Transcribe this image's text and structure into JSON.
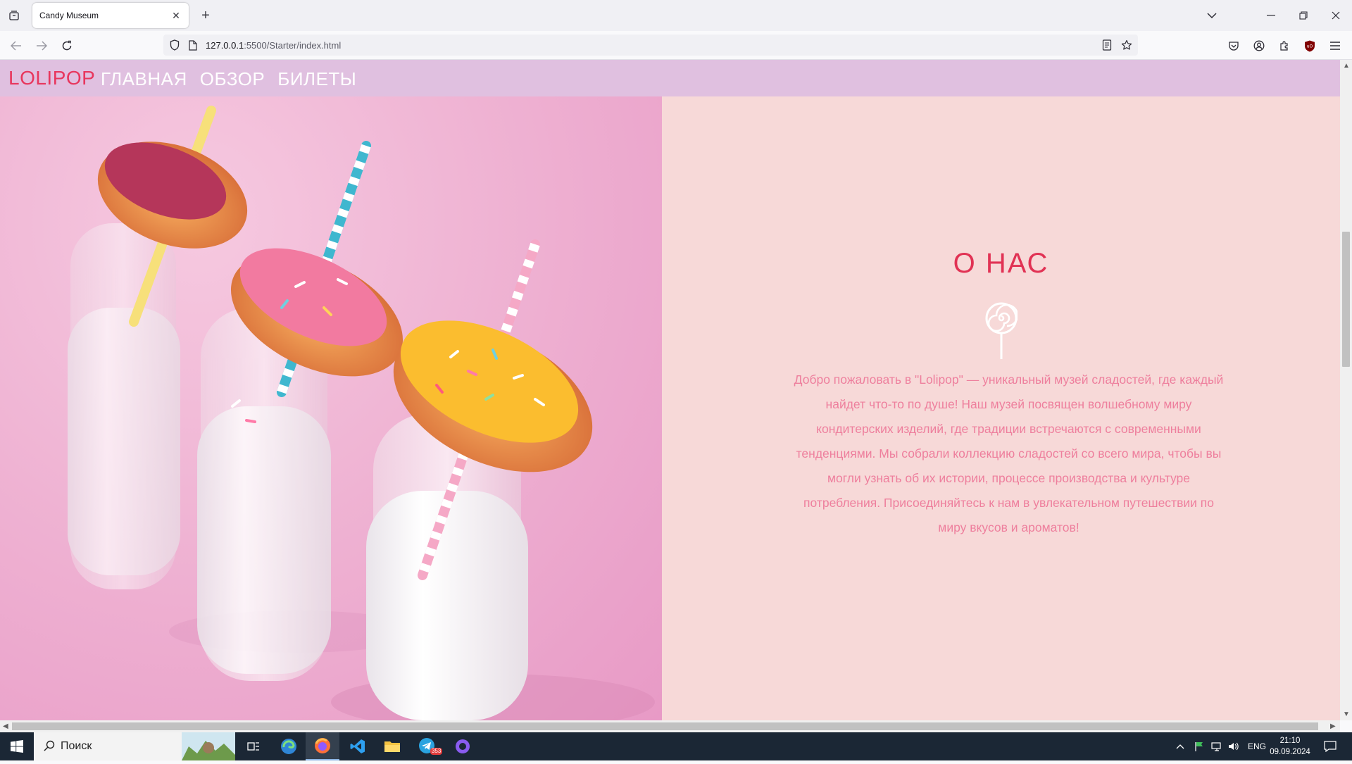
{
  "browser": {
    "tab_title": "Candy Museum",
    "url_host": "127.0.0.1",
    "url_path": ":5500/Starter/index.html"
  },
  "site": {
    "logo": "LOLIPOP",
    "menu": [
      "ГЛАВНАЯ",
      "ОБЗОР",
      "БИЛЕТЫ"
    ],
    "hero_image_alt": "donuts-on-milk-bottles-photo",
    "colors": {
      "header_bg": "#e0c0e0",
      "logo": "#e8365d",
      "about_bg": "#f7d9d8",
      "about_title": "#e13254",
      "about_text": "#ee7f9d"
    }
  },
  "about": {
    "title": "О НАС",
    "text": "Добро пожаловать в \"Lolipop\" — уникальный музей сладостей, где каждый найдет что-то по душе! Наш музей посвящен волшебному миру кондитерских изделий, где традиции встречаются с современными тенденциями. Мы собрали коллекцию сладостей со всего мира, чтобы вы могли узнать об их истории, процессе производства и культуре потребления. Присоединяйтесь к нам в увлекательном путешествии по миру вкусов и ароматов!"
  },
  "taskbar": {
    "search_placeholder": "Поиск",
    "telegram_badge": "353",
    "language": "ENG",
    "time": "21:10",
    "date": "09.09.2024"
  }
}
